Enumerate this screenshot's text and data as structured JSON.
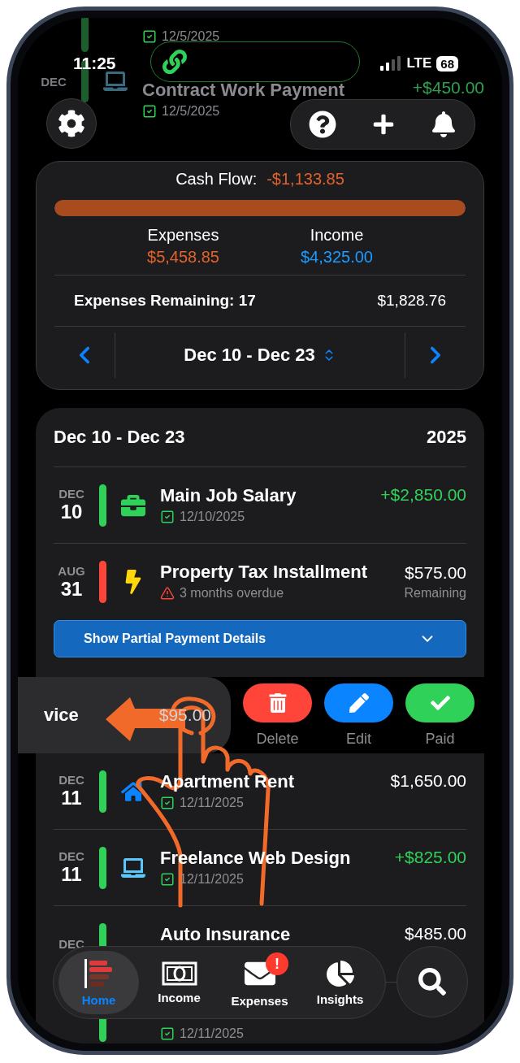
{
  "background_rows": [
    {
      "date": "12/5/2025",
      "paid": true
    },
    {
      "month": "DEC",
      "title": "Contract Work Payment",
      "amount": "+$450.00",
      "positive": true,
      "date": "12/5/2025",
      "paid": true
    }
  ],
  "status_bar": {
    "time": "11:25",
    "network": "LTE",
    "battery": "68"
  },
  "summary": {
    "cash_flow_label": "Cash Flow:",
    "cash_flow_value": "-$1,133.85",
    "level": 1,
    "expenses_label": "Expenses",
    "expenses_value": "$5,458.85",
    "income_label": "Income",
    "income_value": "$4,325.00",
    "remaining_label": "Expenses Remaining: 17",
    "remaining_value": "$1,828.76",
    "period": "Dec 10 - Dec 23"
  },
  "list": {
    "title": "Dec 10 - Dec 23",
    "year": "2025",
    "rows": [
      {
        "kind": "entry",
        "month": "DEC",
        "day": "10",
        "color": "#30d158",
        "title": "Main Job Salary",
        "date": "12/10/2025",
        "paid": true,
        "amount": "+$2,850.00",
        "positive": true
      },
      {
        "kind": "entry",
        "month": "AUG",
        "day": "31",
        "color": "#ff453a",
        "title": "Property Tax Installment",
        "status": "3 months overdue",
        "overdue": true,
        "amount": "$575.00",
        "positive": false,
        "note": "Remaining",
        "details_button": {
          "label": "Show Partial Payment Details",
          "expanded": false
        }
      },
      {
        "kind": "swiped",
        "title": "vice",
        "amount": "$95.00",
        "actions": [
          {
            "label": "Delete",
            "kind": "delete"
          },
          {
            "label": "Edit",
            "kind": "edit"
          },
          {
            "label": "Paid",
            "kind": "paid"
          }
        ]
      },
      {
        "kind": "entry",
        "month": "DEC",
        "day": "11",
        "color": "#30d158",
        "title": "Apartment Rent",
        "date": "12/11/2025",
        "paid": true,
        "amount": "$1,650.00",
        "positive": false
      },
      {
        "kind": "entry",
        "month": "DEC",
        "day": "11",
        "color": "#30d158",
        "title": "Freelance Web Design",
        "date": "12/11/2025",
        "paid": true,
        "amount": "+$825.00",
        "positive": true
      },
      {
        "kind": "entry",
        "month": "DEC",
        "color": "#30d158",
        "title": "Auto Insurance",
        "amount": "$485.00",
        "positive": false
      },
      {
        "kind": "entry",
        "color": "#30d158",
        "date": "12/11/2025",
        "paid": true
      }
    ]
  },
  "nav": {
    "tabs": [
      {
        "label": "Home",
        "selected": true
      },
      {
        "label": "Income",
        "selected": false
      },
      {
        "label": "Expenses",
        "selected": false,
        "badge": "!"
      },
      {
        "label": "Insights",
        "selected": false
      }
    ]
  }
}
